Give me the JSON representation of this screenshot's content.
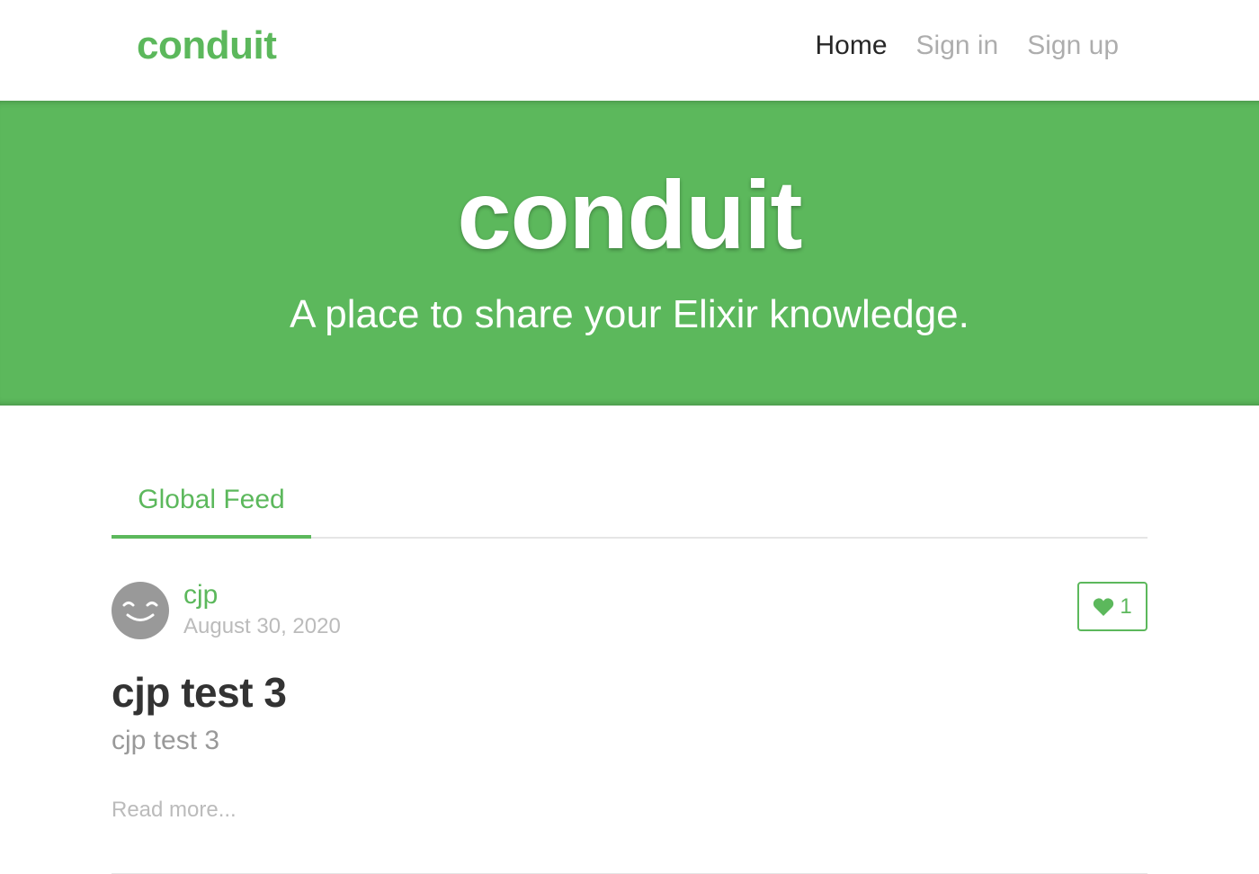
{
  "navbar": {
    "brand": "conduit",
    "links": [
      {
        "label": "Home",
        "active": true
      },
      {
        "label": "Sign in",
        "active": false
      },
      {
        "label": "Sign up",
        "active": false
      }
    ]
  },
  "banner": {
    "title": "conduit",
    "subtitle": "A place to share your Elixir knowledge."
  },
  "feed": {
    "tabs": [
      {
        "label": "Global Feed",
        "active": true
      }
    ],
    "articles": [
      {
        "author": "cjp",
        "date": "August 30, 2020",
        "favorites_count": "1",
        "title": "cjp test 3",
        "description": "cjp test 3",
        "read_more": "Read more...",
        "avatar_icon": "smiley-avatar-icon",
        "favorite_icon": "heart-icon"
      }
    ]
  },
  "colors": {
    "brand_green": "#5cb85c",
    "text_dark": "#333333",
    "text_muted": "#999999",
    "text_light": "#bbbbbb",
    "divider": "#e5e5e5"
  }
}
